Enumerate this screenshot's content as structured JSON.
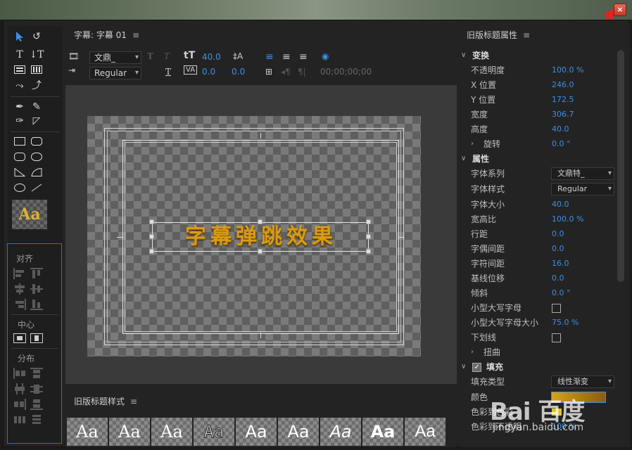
{
  "window": {
    "close_label": "×"
  },
  "tools": {
    "style_sample": "Aa"
  },
  "align_panel": {
    "align_label": "对齐",
    "center_label": "中心",
    "distribute_label": "分布"
  },
  "designer": {
    "tab_title": "字幕: 字幕 01",
    "menu_icon": "≡",
    "font_family": "文鼎_",
    "font_style": "Regular",
    "font_size": "40.0",
    "leading": "0.0",
    "kerning": "0.0",
    "timecode": "00;00;00;00",
    "title_text": "字幕弹跳效果"
  },
  "styles_panel": {
    "title": "旧版标题样式",
    "menu_icon": "≡",
    "swatches": [
      "Aa",
      "Aa",
      "Aa",
      "Aa",
      "Aa",
      "Aa",
      "Aa",
      "Aa",
      "Aa"
    ]
  },
  "properties": {
    "title": "旧版标题属性",
    "menu_icon": "≡",
    "transform": {
      "label": "变换",
      "opacity_label": "不透明度",
      "opacity": "100.0 %",
      "x_label": "X 位置",
      "x": "246.0",
      "y_label": "Y 位置",
      "y": "172.5",
      "width_label": "宽度",
      "width": "306.7",
      "height_label": "高度",
      "height": "40.0",
      "rotation_label": "旋转",
      "rotation": "0.0 °"
    },
    "properties": {
      "label": "属性",
      "font_family_label": "字体系列",
      "font_family": "文鼎特_",
      "font_style_label": "字体样式",
      "font_style": "Regular",
      "font_size_label": "字体大小",
      "font_size": "40.0",
      "aspect_label": "宽高比",
      "aspect": "100.0 %",
      "leading_label": "行距",
      "leading": "0.0",
      "kerning_label": "字偶间距",
      "kerning": "0.0",
      "tracking_label": "字符间距",
      "tracking": "16.0",
      "baseline_label": "基线位移",
      "baseline": "0.0",
      "slant_label": "倾斜",
      "slant": "0.0 °",
      "small_caps_label": "小型大写字母",
      "small_caps_size_label": "小型大写字母大小",
      "small_caps_size": "75.0 %",
      "underline_label": "下划线",
      "distort_label": "扭曲"
    },
    "fill": {
      "label": "填充",
      "fill_type_label": "填充类型",
      "fill_type": "线性渐变",
      "color_label": "颜色",
      "color_stop_label": "色彩到色彩",
      "color_opacity_label": "色彩到不透明",
      "color_opacity": "100 %"
    }
  },
  "watermark": {
    "brand": "Bai 百度",
    "site": "jingyan.baidu.com"
  }
}
